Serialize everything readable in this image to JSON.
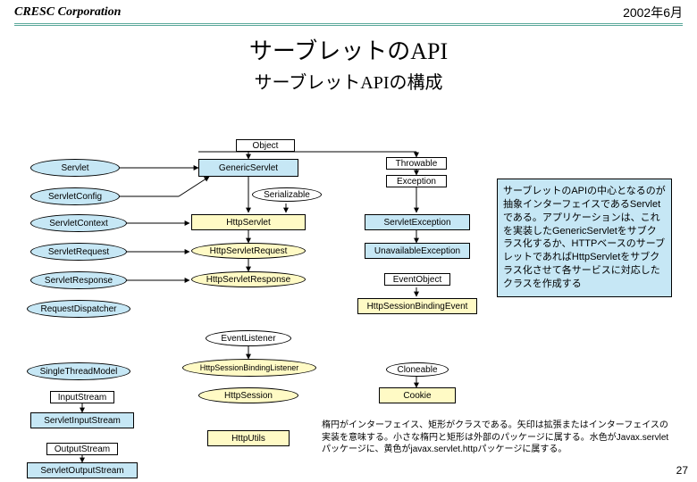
{
  "header": {
    "company": "CRESC Corporation",
    "date": "2002年6月"
  },
  "title": "サーブレットのAPI",
  "subtitle": "サーブレットAPIの構成",
  "pageNumber": "27",
  "sideText": "サーブレットのAPIの中心となるのが抽象インターフェイスであるServletである。アプリケーションは、これを実装したGenericServletをサブクラス化するか、HTTPベースのサーブレットであればHttpServletをサブクラス化させて各サービスに対応したクラスを作成する",
  "footnote": "楕円がインターフェイス、矩形がクラスである。矢印は拡張またはインターフェイスの実装を意味する。小さな楕円と矩形は外部のパッケージに属する。水色がJavax.servletパッケージに、黄色がjavax.servlet.httpパッケージに属する。",
  "nodes": {
    "object": "Object",
    "servlet": "Servlet",
    "genericServlet": "GenericServlet",
    "servletConfig": "ServletConfig",
    "serializable": "Serializable",
    "servletContext": "ServletContext",
    "httpServlet": "HttpServlet",
    "servletRequest": "ServletRequest",
    "httpServletRequest": "HttpServletRequest",
    "servletResponse": "ServletResponse",
    "httpServletResponse": "HttpServletResponse",
    "requestDispatcher": "RequestDispatcher",
    "eventListener": "EventListener",
    "singleThreadModel": "SingleThreadModel",
    "httpSessionBindingListener": "HttpSessionBindingListener",
    "inputStream": "InputStream",
    "httpSession": "HttpSession",
    "servletInputStream": "ServletInputStream",
    "httpUtils": "HttpUtils",
    "outputStream": "OutputStream",
    "servletOutputStream": "ServletOutputStream",
    "throwable": "Throwable",
    "exception": "Exception",
    "servletException": "ServletException",
    "unavailableException": "UnavailableException",
    "eventObject": "EventObject",
    "httpSessionBindingEvent": "HttpSessionBindingEvent",
    "cloneable": "Cloneable",
    "cookie": "Cookie"
  }
}
